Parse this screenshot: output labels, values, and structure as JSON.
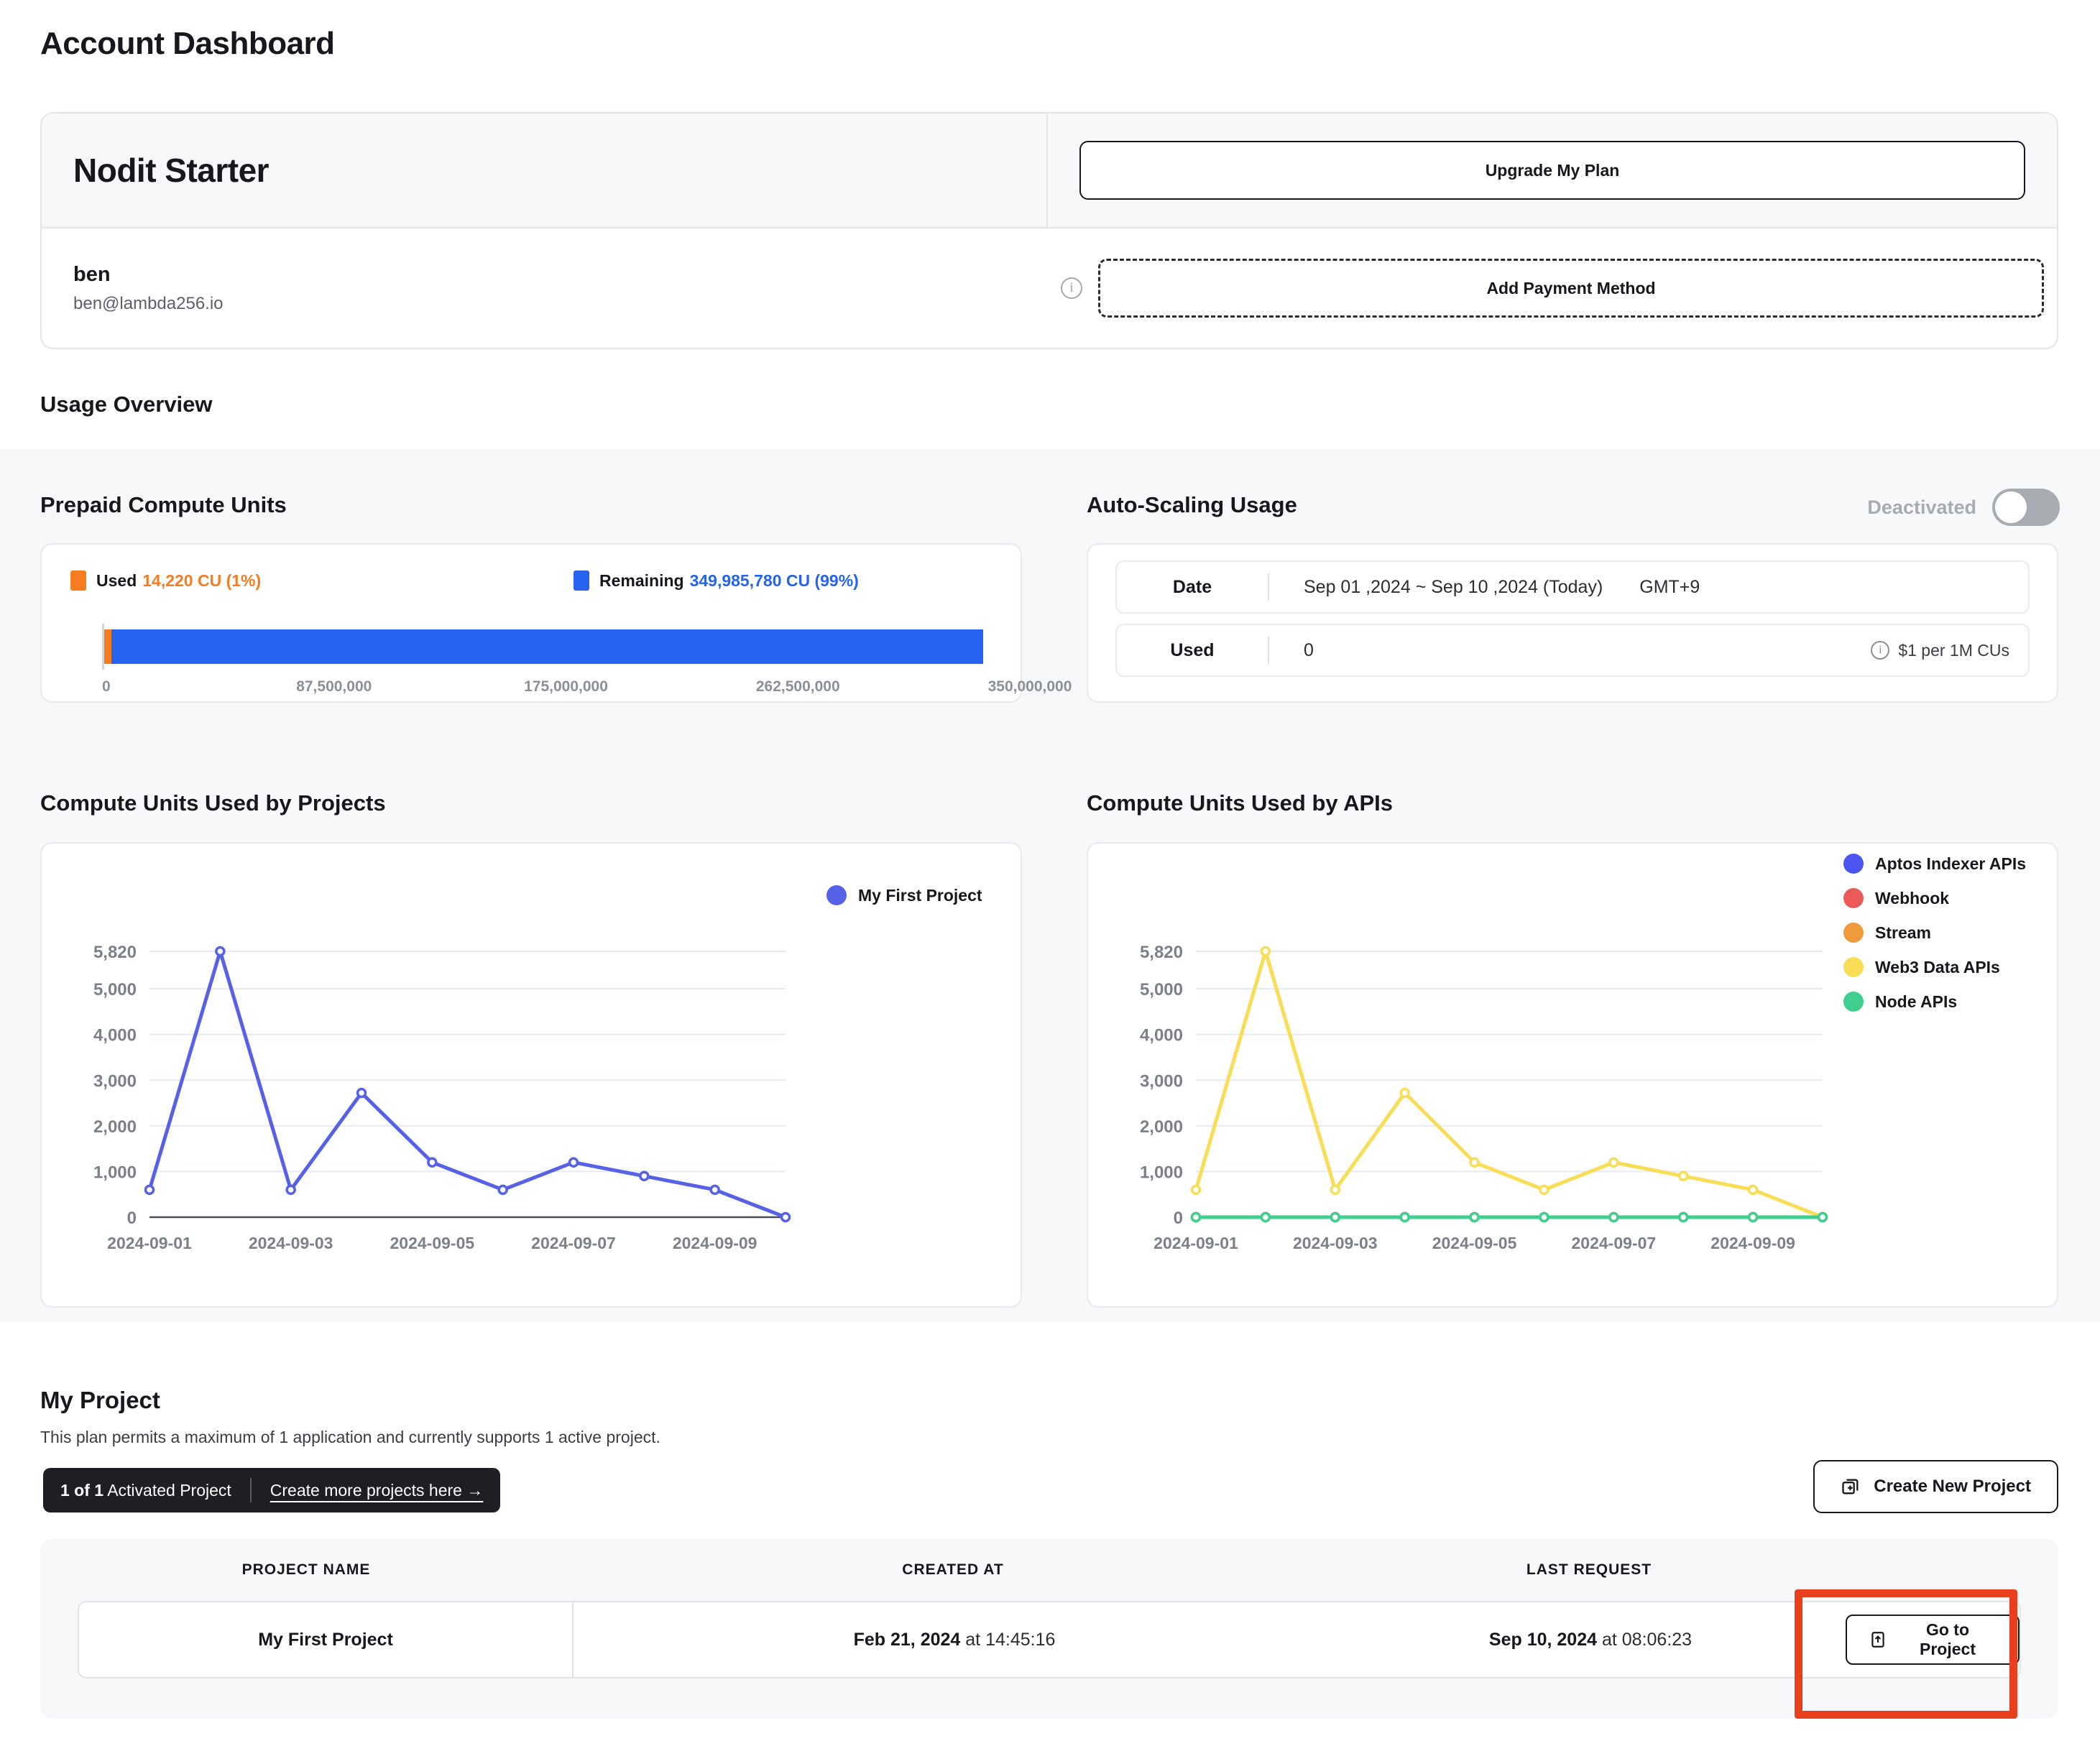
{
  "page_title": "Account Dashboard",
  "plan": {
    "name": "Nodit Starter",
    "upgrade_label": "Upgrade My Plan",
    "user_name": "ben",
    "user_email": "ben@lambda256.io",
    "payment_label": "Add Payment Method",
    "info_icon": "info-icon"
  },
  "usage_overview": {
    "heading": "Usage Overview",
    "prepaid": {
      "title": "Prepaid Compute Units",
      "used_label": "Used",
      "used_value": "14,220 CU (1%)",
      "remaining_label": "Remaining",
      "remaining_value": "349,985,780 CU (99%)",
      "used_color": "#f57c20",
      "remaining_color": "#2563f0",
      "axis_ticks": [
        "0",
        "87,500,000",
        "175,000,000",
        "262,500,000",
        "350,000,000"
      ],
      "axis_max": 350000000,
      "used_amount": 14220,
      "remaining_amount": 349985780
    },
    "autoscaling": {
      "title": "Auto-Scaling Usage",
      "toggle_label": "Deactivated",
      "toggle_state": "off",
      "rows": [
        {
          "key": "Date",
          "value": "Sep 01 ,2024 ~ Sep 10 ,2024 (Today)",
          "extra": "GMT+9",
          "note": ""
        },
        {
          "key": "Used",
          "value": "0",
          "extra": "",
          "note": "$1 per 1M CUs"
        }
      ]
    }
  },
  "chart_data": [
    {
      "type": "line",
      "title": "Compute Units Used by Projects",
      "xlabel": "",
      "ylabel": "",
      "x": [
        "2024-09-01",
        "2024-09-02",
        "2024-09-03",
        "2024-09-04",
        "2024-09-05",
        "2024-09-06",
        "2024-09-07",
        "2024-09-08",
        "2024-09-09",
        "2024-09-10"
      ],
      "xtick_labels": [
        "2024-09-01",
        "2024-09-03",
        "2024-09-05",
        "2024-09-07",
        "2024-09-09"
      ],
      "ytick_labels": [
        "0",
        "1,000",
        "2,000",
        "3,000",
        "4,000",
        "5,000",
        "5,820"
      ],
      "ylim": [
        0,
        5820
      ],
      "grid": true,
      "legend_position": "top-right",
      "series": [
        {
          "name": "My First Project",
          "color": "#5562e8",
          "values": [
            600,
            5820,
            600,
            2720,
            1200,
            600,
            1200,
            900,
            600,
            0
          ]
        }
      ]
    },
    {
      "type": "line",
      "title": "Compute Units Used by APIs",
      "xlabel": "",
      "ylabel": "",
      "x": [
        "2024-09-01",
        "2024-09-02",
        "2024-09-03",
        "2024-09-04",
        "2024-09-05",
        "2024-09-06",
        "2024-09-07",
        "2024-09-08",
        "2024-09-09",
        "2024-09-10"
      ],
      "xtick_labels": [
        "2024-09-01",
        "2024-09-03",
        "2024-09-05",
        "2024-09-07",
        "2024-09-09"
      ],
      "ytick_labels": [
        "0",
        "1,000",
        "2,000",
        "3,000",
        "4,000",
        "5,000",
        "5,820"
      ],
      "ylim": [
        0,
        5820
      ],
      "grid": true,
      "legend_position": "right",
      "series": [
        {
          "name": "Aptos Indexer APIs",
          "color": "#4b56f0",
          "values": [
            0,
            0,
            0,
            0,
            0,
            0,
            0,
            0,
            0,
            0
          ]
        },
        {
          "name": "Webhook",
          "color": "#ec5a58",
          "values": [
            0,
            0,
            0,
            0,
            0,
            0,
            0,
            0,
            0,
            0
          ]
        },
        {
          "name": "Stream",
          "color": "#ef9a3c",
          "values": [
            0,
            0,
            0,
            0,
            0,
            0,
            0,
            0,
            0,
            0
          ]
        },
        {
          "name": "Web3 Data APIs",
          "color": "#f8dd55",
          "values": [
            600,
            5820,
            600,
            2720,
            1200,
            600,
            1200,
            900,
            600,
            0
          ]
        },
        {
          "name": "Node APIs",
          "color": "#3ecf8e",
          "values": [
            0,
            0,
            0,
            0,
            0,
            0,
            0,
            0,
            0,
            0
          ]
        }
      ]
    }
  ],
  "my_project": {
    "title": "My Project",
    "subtitle": "This plan permits a maximum of 1 application and currently supports 1 active project.",
    "badge_count_bold": "1 of 1",
    "badge_count_rest": " Activated Project",
    "badge_link": "Create more projects here →",
    "create_button": "Create New Project",
    "columns": [
      "PROJECT NAME",
      "CREATED AT",
      "LAST REQUEST",
      ""
    ],
    "rows": [
      {
        "name": "My First Project",
        "created_at_date": "Feb 21, 2024",
        "created_at_time": " at 14:45:16",
        "last_request_date": "Sep 10, 2024",
        "last_request_time": " at 08:06:23",
        "action_label": "Go to Project"
      }
    ],
    "highlight_color": "#e8401c"
  }
}
